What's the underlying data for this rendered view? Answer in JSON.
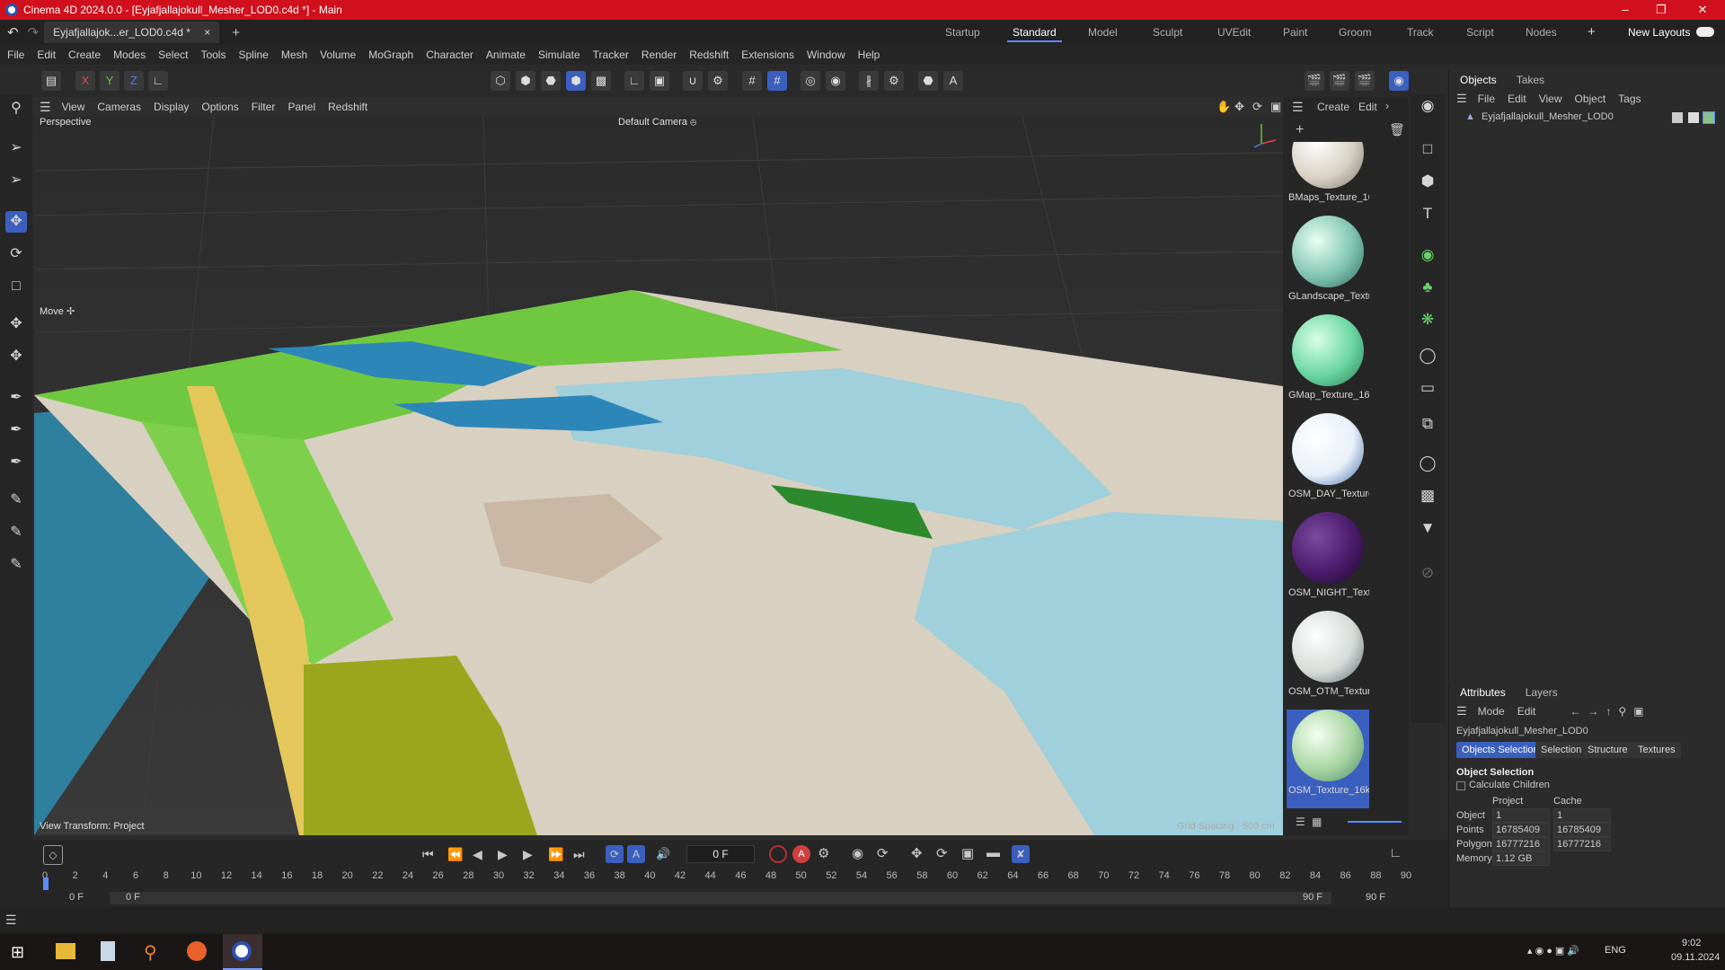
{
  "window": {
    "title": "Cinema 4D 2024.0.0 - [Eyjafjallajokull_Mesher_LOD0.c4d *] - Main"
  },
  "doc_tab": {
    "label": "Eyjafjallajok...er_LOD0.c4d *",
    "close": "×",
    "add": "+"
  },
  "layouts": [
    "Startup",
    "Standard",
    "Model",
    "Sculpt",
    "UVEdit",
    "Paint",
    "Groom",
    "Track",
    "Script",
    "Nodes"
  ],
  "layouts_add": "+",
  "new_layouts": "New Layouts",
  "menu": [
    "File",
    "Edit",
    "Create",
    "Modes",
    "Select",
    "Tools",
    "Spline",
    "Mesh",
    "Volume",
    "MoGraph",
    "Character",
    "Animate",
    "Simulate",
    "Tracker",
    "Render",
    "Redshift",
    "Extensions",
    "Window",
    "Help"
  ],
  "axes": {
    "x": "X",
    "y": "Y",
    "z": "Z"
  },
  "viewport": {
    "menu": [
      "View",
      "Cameras",
      "Display",
      "Options",
      "Filter",
      "Panel",
      "Redshift"
    ],
    "name": "Perspective",
    "camera": "Default Camera",
    "camera_icon": "⦺",
    "tool_label": "Move",
    "tool_icon": "✢",
    "transform": "View Transform: Project",
    "grid": "Grid Spacing : 500 cm"
  },
  "material_panel": {
    "menu": [
      "Create",
      "Edit"
    ],
    "materials": [
      {
        "name": "BMaps_Texture_16",
        "color": "#d8d2c4"
      },
      {
        "name": "GLandscape_Textu",
        "color": "#7fc4b0"
      },
      {
        "name": "GMap_Texture_16",
        "color": "#6ad6a0"
      },
      {
        "name": "OSM_DAY_Texture",
        "color": "#e8f0f8"
      },
      {
        "name": "OSM_NIGHT_Textu",
        "color": "#4a1b6a"
      },
      {
        "name": "OSM_OTM_Textur",
        "color": "#d6dcd8"
      },
      {
        "name": "OSM_Texture_16k",
        "color": "#a6d4a0"
      }
    ]
  },
  "objects_panel": {
    "tabs": [
      "Objects",
      "Takes"
    ],
    "menu": [
      "File",
      "Edit",
      "View",
      "Object",
      "Tags"
    ],
    "object_name": "Eyjafjallajokull_Mesher_LOD0"
  },
  "attributes_panel": {
    "tabs": [
      "Attributes",
      "Layers"
    ],
    "menu": [
      "Mode",
      "Edit"
    ],
    "object_name": "Eyjafjallajokull_Mesher_LOD0",
    "buttons": [
      "Objects Selection",
      "Selection",
      "Structure",
      "Textures"
    ],
    "section": "Object Selection",
    "calc_children": "Calculate Children",
    "col_project": "Project",
    "col_cache": "Cache",
    "rows": [
      {
        "label": "Object",
        "project": "1",
        "cache": "1"
      },
      {
        "label": "Points",
        "project": "16785409",
        "cache": "16785409"
      },
      {
        "label": "Polygons",
        "project": "16777216",
        "cache": "16777216"
      },
      {
        "label": "Memory",
        "project": "1.12 GB",
        "cache": ""
      }
    ]
  },
  "timeline": {
    "current_frame": "0 F",
    "ticks": [
      "0",
      "2",
      "4",
      "6",
      "8",
      "10",
      "12",
      "14",
      "16",
      "18",
      "20",
      "22",
      "24",
      "26",
      "28",
      "30",
      "32",
      "34",
      "36",
      "38",
      "40",
      "42",
      "44",
      "46",
      "48",
      "50",
      "52",
      "54",
      "56",
      "58",
      "60",
      "62",
      "64",
      "66",
      "68",
      "70",
      "72",
      "74",
      "76",
      "78",
      "80",
      "82",
      "84",
      "86",
      "88",
      "90"
    ],
    "start_a": "0 F",
    "start_b": "0 F",
    "end_a": "90 F",
    "end_b": "90 F"
  },
  "taskbar": {
    "lang": "ENG",
    "time": "9:02",
    "date": "09.11.2024"
  },
  "colors": {
    "accent": "#3b5fbf",
    "title_bar": "#d0101c"
  }
}
